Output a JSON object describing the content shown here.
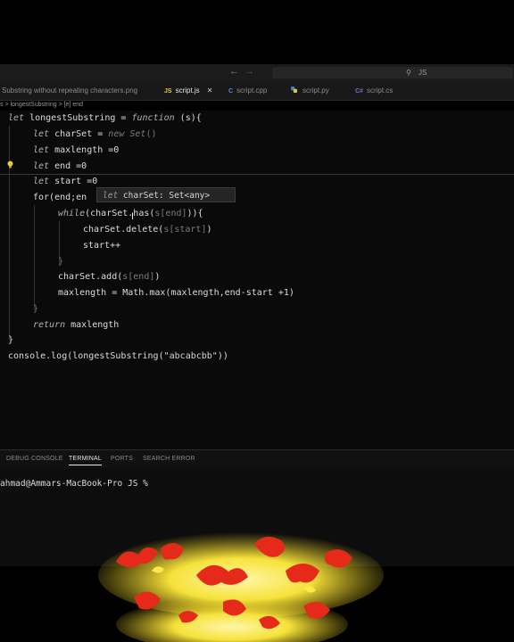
{
  "topbar": {
    "back_arrow": "←",
    "forward_arrow": "→",
    "search_label": "JS"
  },
  "tabs": [
    {
      "label": "Substring without repeating characters.png",
      "icon": "",
      "active": false
    },
    {
      "label": "script.js",
      "icon": "JS",
      "active": true
    },
    {
      "label": "script.cpp",
      "icon": "C",
      "active": false
    },
    {
      "label": "script.py",
      "icon": "",
      "active": false
    },
    {
      "label": "script.cs",
      "icon": "C#",
      "active": false
    }
  ],
  "breadcrumb": "s > longestSubstring > [e] end",
  "code": {
    "l1_kw": "let",
    "l1_name": " longestSubstring = ",
    "l1_fn": "function",
    "l1_rest": " (s){",
    "l2_kw": "let",
    "l2_rest": " charSet = ",
    "l2_new": "new",
    "l2_set": " Set",
    "l2_end": "()",
    "l3_kw": "let",
    "l3_rest": " maxlength =0",
    "l4_kw": "let",
    "l4_rest": " end =0",
    "l5_kw": "let",
    "l5_rest": " start =0",
    "l6": "for(end;en",
    "l7_kw": "while",
    "l7_rest": "(charSet.has(",
    "l7_dim": "s[end]",
    "l7_end": ")){",
    "l8": "charSet.delete(",
    "l8_dim": "s[start]",
    "l8_end": ")",
    "l9": "start++",
    "l10": "}",
    "l11": "charSet.add(",
    "l11_dim": "s[end]",
    "l11_end": ")",
    "l12": "maxlength = Math.max(maxlength,end-start +1)",
    "l13": "}",
    "l14_kw": "return",
    "l14_rest": " maxlength",
    "l15": "}",
    "l16_a": "console.log(longestSubstring(",
    "l16_str": "\"abcabcbb\"",
    "l16_b": "))"
  },
  "tooltip": {
    "kw": "let",
    "rest": " charSet: Set<any>"
  },
  "panel_tabs": [
    "DEBUG CONSOLE",
    "TERMINAL",
    "PORTS",
    "SEARCH ERROR"
  ],
  "terminal": {
    "prompt": "ahmad@Ammars-MacBook-Pro JS %"
  },
  "colors": {
    "accent_js": "#e6c84c",
    "accent_cpp": "#5a8fd6",
    "accent_py": "#4d7fbd",
    "accent_cs": "#8a63c9"
  }
}
